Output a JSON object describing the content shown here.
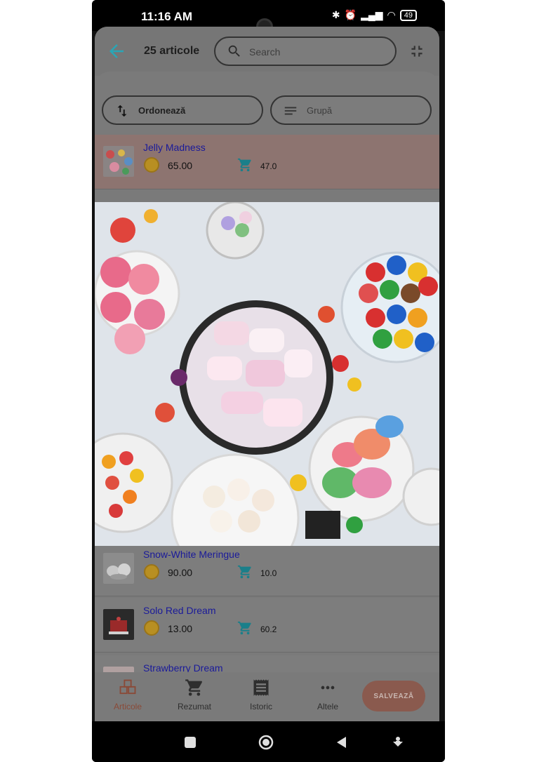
{
  "status": {
    "time": "11:16 AM",
    "battery": "49"
  },
  "header": {
    "title": "25 articole",
    "search_placeholder": "Search"
  },
  "filters": {
    "sort_label": "Ordonează",
    "group_label": "Grupă"
  },
  "items": [
    {
      "name": "Jelly Madness",
      "price": "65.00",
      "qty": "47.0",
      "selected": true
    },
    {
      "name": "Snow-White Meringue",
      "price": "90.00",
      "qty": "10.0"
    },
    {
      "name": "Solo Red Dream",
      "price": "13.00",
      "qty": "60.2"
    },
    {
      "name": "Strawberry Dream",
      "price": "",
      "qty": ""
    }
  ],
  "bottom_nav": {
    "items": [
      {
        "label": "Articole",
        "icon": "boxes-icon",
        "active": true
      },
      {
        "label": "Rezumat",
        "icon": "cart-icon"
      },
      {
        "label": "Istoric",
        "icon": "receipt-icon"
      },
      {
        "label": "Altele",
        "icon": "more-icon"
      }
    ],
    "save_label": "SALVEAZĂ"
  },
  "colors": {
    "accent": "#2aa6b6",
    "link": "#1a1a9a",
    "selected_row": "#8d7470",
    "save_button": "#8a5a4e"
  }
}
